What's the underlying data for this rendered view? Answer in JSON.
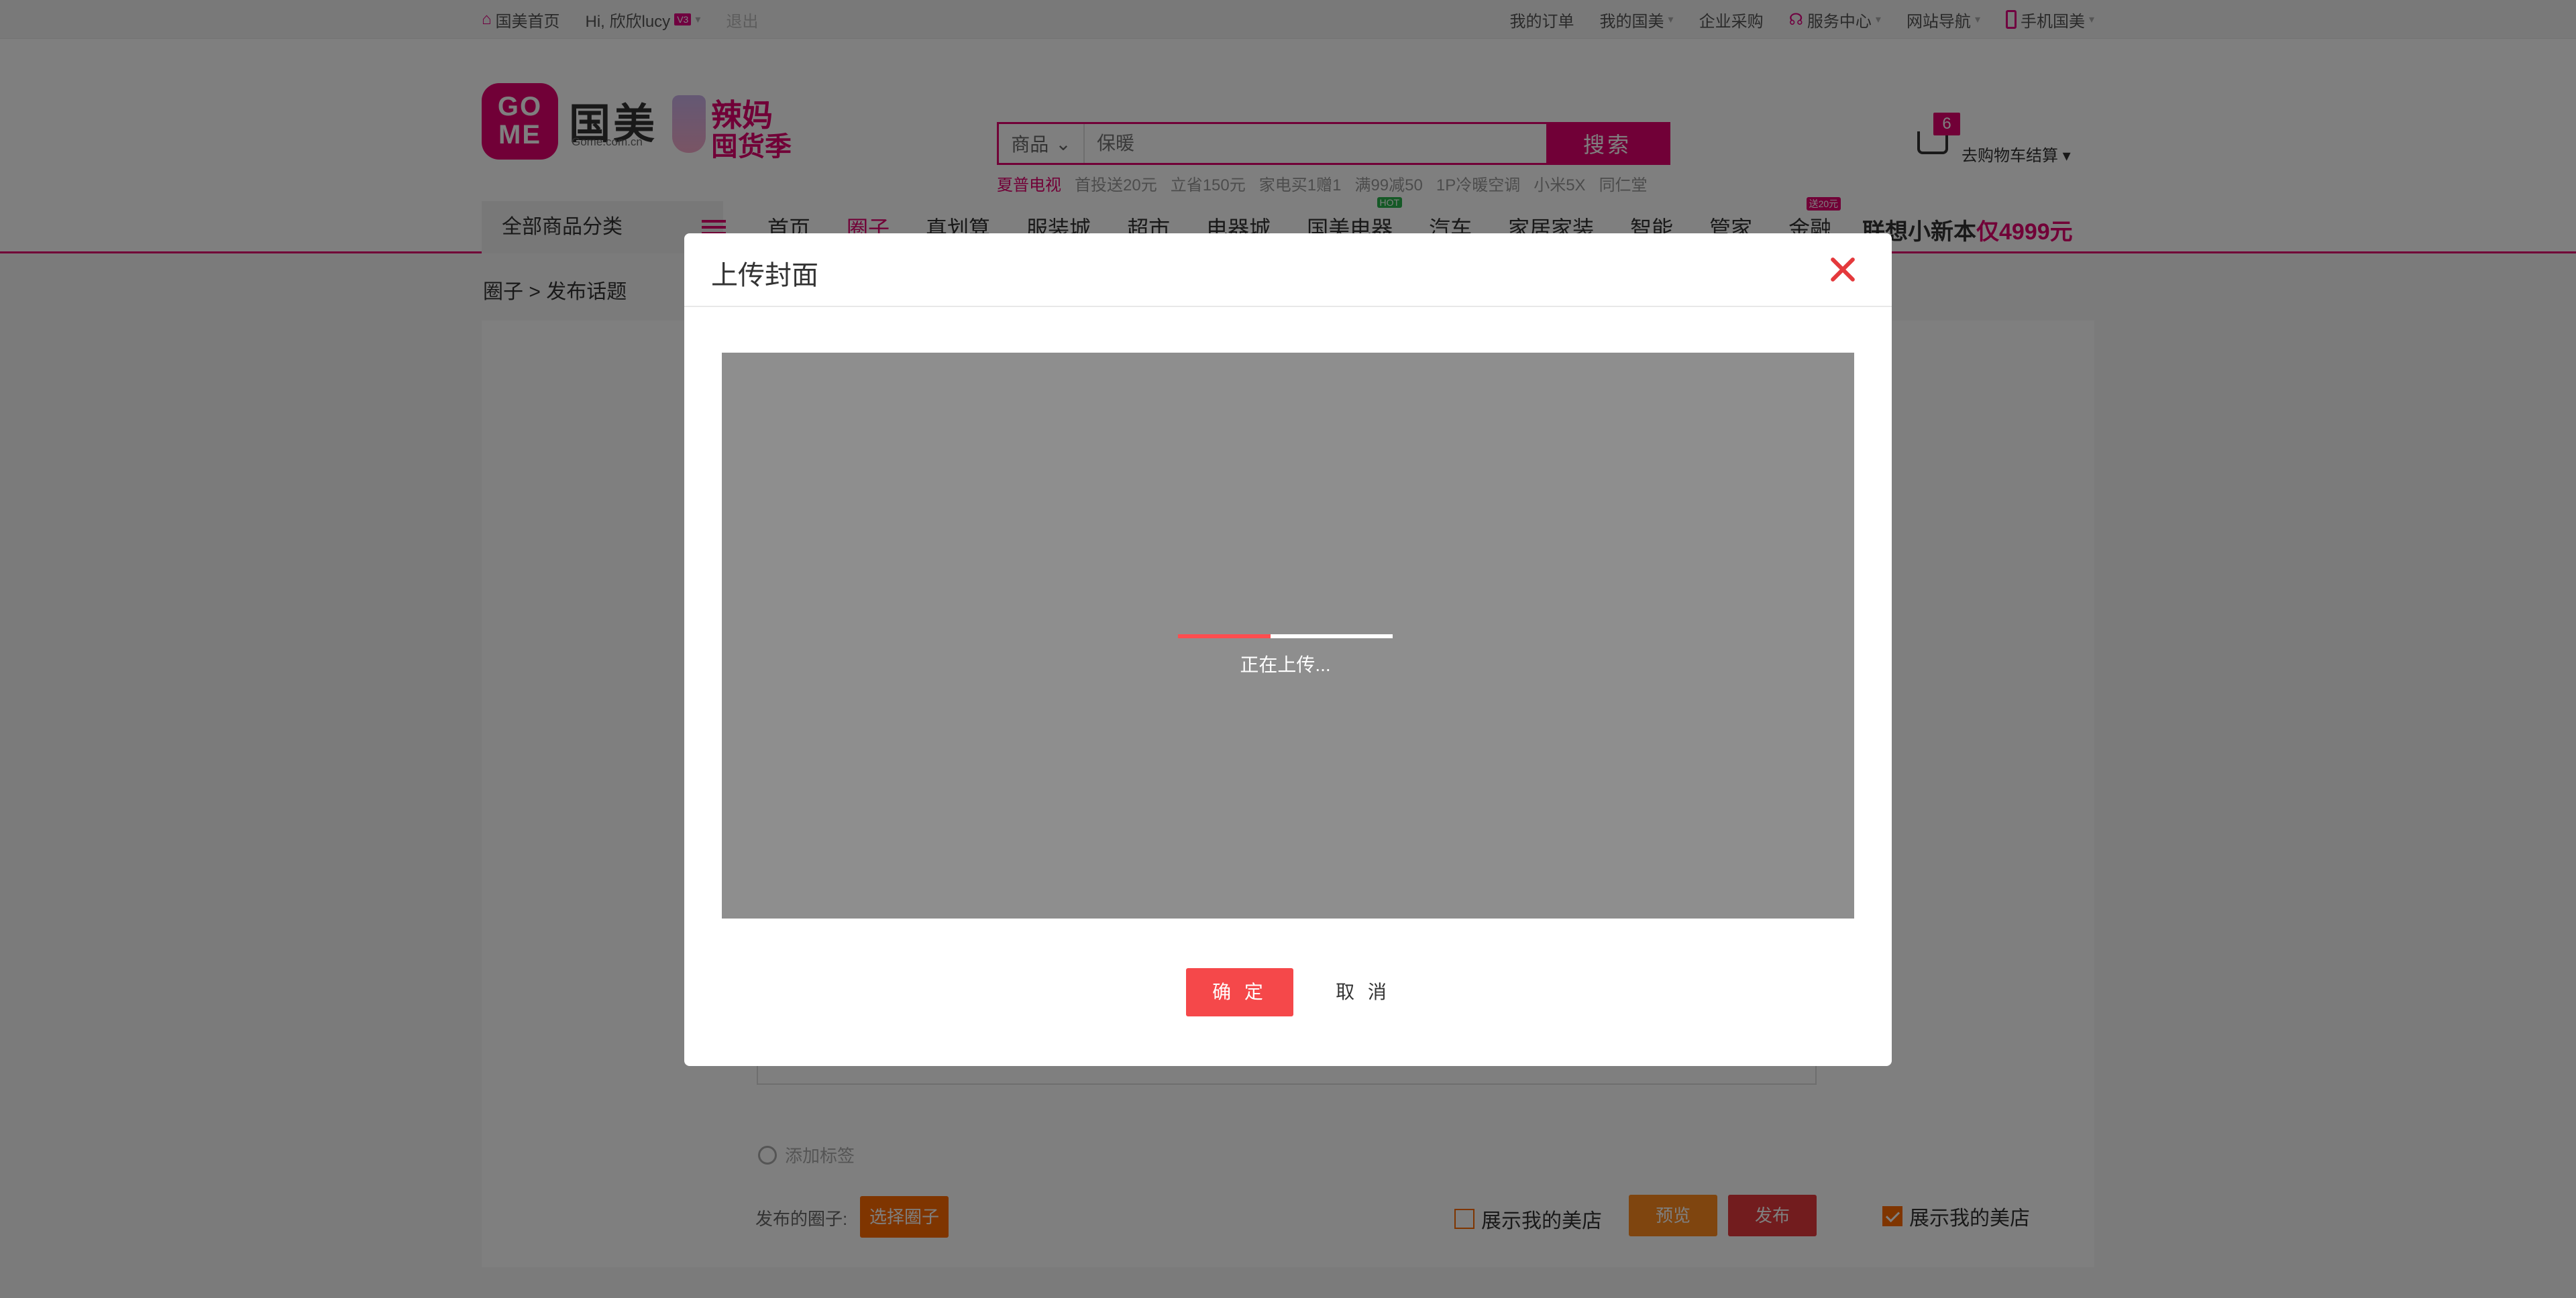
{
  "topbar": {
    "home": "国美首页",
    "greeting": "Hi, 欣欣lucy",
    "vip_badge": "V3",
    "logout": "退出",
    "links": [
      "我的订单",
      "我的国美",
      "企业采购",
      "服务中心",
      "网站导航",
      "手机国美"
    ]
  },
  "header": {
    "logo_text": "GO ME",
    "brand_cn": "国美",
    "brand_en": "Gome.com.cn",
    "promo_line1": "辣妈",
    "promo_line2": "囤货季",
    "search": {
      "category": "商品",
      "placeholder": "保暖",
      "button": "搜索",
      "hotwords": [
        "夏普电视",
        "首投送20元",
        "立省150元",
        "家电买1赠1",
        "满99减50",
        "1P冷暖空调",
        "小米5X",
        "同仁堂"
      ]
    },
    "cart": {
      "count": "6",
      "label": "去购物车结算"
    }
  },
  "nav": {
    "all_categories": "全部商品分类",
    "items": [
      {
        "label": "首页",
        "tag": ""
      },
      {
        "label": "圈子",
        "tag": ""
      },
      {
        "label": "真划算",
        "tag": ""
      },
      {
        "label": "服装城",
        "tag": ""
      },
      {
        "label": "超市",
        "tag": ""
      },
      {
        "label": "电器城",
        "tag": ""
      },
      {
        "label": "国美电器",
        "tag": "HOT"
      },
      {
        "label": "汽车",
        "tag": ""
      },
      {
        "label": "家居家装",
        "tag": ""
      },
      {
        "label": "智能",
        "tag": ""
      },
      {
        "label": "管家",
        "tag": ""
      },
      {
        "label": "金融",
        "tag": "送20元"
      }
    ],
    "active_index": 1,
    "ad_prefix": "联想小新本",
    "ad_highlight": "仅4999元"
  },
  "page": {
    "breadcrumb": "圈子 > 发布话题",
    "add_tag": "添加标签",
    "circle_label": "发布的圈子:",
    "choose_circle": "选择圈子",
    "show_store_1": "展示我的美店",
    "preview": "预览",
    "publish": "发布",
    "show_store_2": "展示我的美店"
  },
  "modal": {
    "title": "上传封面",
    "progress_text": "正在上传...",
    "progress_fraction": 0.43,
    "confirm": "确 定",
    "cancel": "取 消"
  },
  "colors": {
    "brand": "#e3006e",
    "danger": "#f5484a",
    "warning": "#ff6a00"
  }
}
